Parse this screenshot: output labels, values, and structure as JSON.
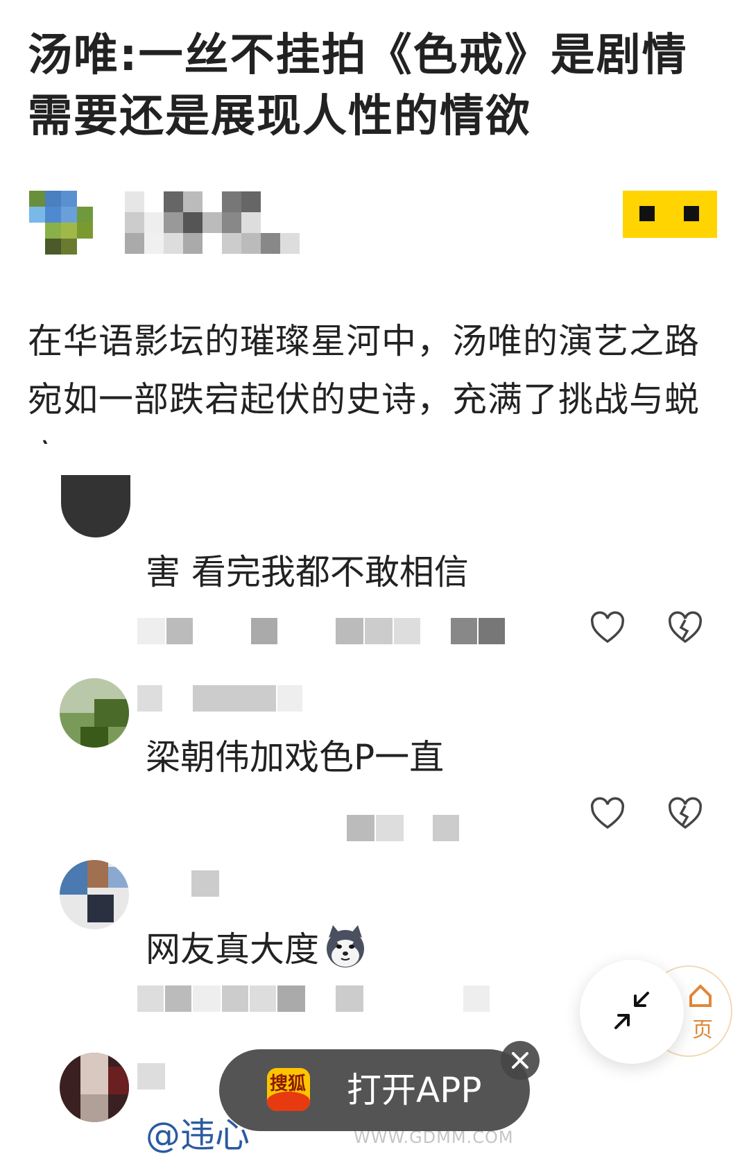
{
  "article": {
    "title": "汤唯:一丝不挂拍《色戒》是剧情需要还是展现人性的情欲",
    "body": "在华语影坛的璀璨星河中，汤唯的演艺之路宛如一部跌宕起伏的史诗，充满了挑战与蜕变。"
  },
  "comments": [
    {
      "text": "害 看完我都不敢相信",
      "like_icon": "heart-outline-icon",
      "dislike_icon": "broken-heart-icon"
    },
    {
      "text": "梁朝伟加戏色P一直",
      "like_icon": "heart-outline-icon",
      "dislike_icon": "broken-heart-icon"
    },
    {
      "text": "网友真大度",
      "emoji": "husky-emoji-icon"
    },
    {
      "text": "@违心"
    }
  ],
  "floating": {
    "collapse_icon": "collapse-arrows-icon",
    "home_label": "页",
    "open_app_label": "打开APP",
    "app_logo_text": "搜狐",
    "close_icon": "close-icon"
  },
  "watermark": "WWW.GDMM.COM",
  "colors": {
    "follow_button": "#ffd400",
    "open_app_bg": "#3c3c3c",
    "mention": "#2b5aa0",
    "home_accent": "#e0873a"
  }
}
